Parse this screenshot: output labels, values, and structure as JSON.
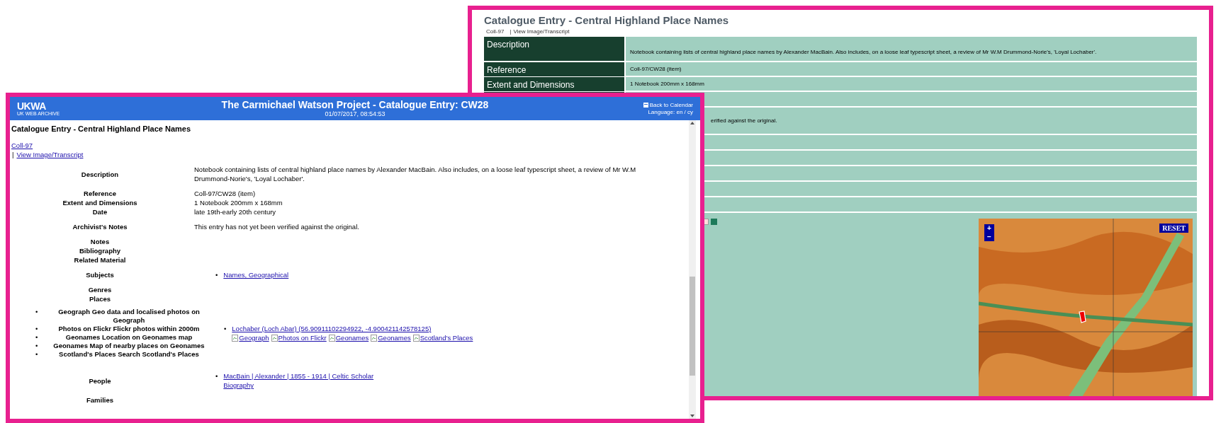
{
  "back_window": {
    "title": "Catalogue Entry - Central Highland Place Names",
    "links": [
      "Coll-97",
      "View Image/Transcript"
    ],
    "separator": "|",
    "rows": [
      {
        "label": "Description",
        "value": "Notebook containing lists of central highland place names by Alexander MacBain. Also includes, on a loose leaf typescript sheet, a review of Mr W.M Drummond-Norie's, 'Loyal Lochaber'."
      },
      {
        "label": "Reference",
        "value": "Coll-97/CW28 (item)"
      },
      {
        "label": "Extent and Dimensions",
        "value": "1 Notebook 200mm x 168mm"
      }
    ],
    "partly_covered_value": "erified against the original.",
    "map": {
      "zoom_in": "+",
      "zoom_out": "−",
      "reset_button": "RESET"
    }
  },
  "front_window": {
    "header": {
      "logo": "UKWA",
      "logo_subtitle": "UK WEB ARCHIVE",
      "title": "The Carmichael Watson Project - Catalogue Entry: CW28",
      "timestamp": "01/07/2017, 08:54:53",
      "back_link": "Back to Calendar",
      "language": "Language: en / cy"
    },
    "heading": "Catalogue Entry - Central Highland Place Names",
    "links": [
      "Coll-97",
      "View Image/Transcript"
    ],
    "separator": "|",
    "bullet": "•",
    "sections": [
      [
        {
          "kind": "text",
          "label": "Description",
          "value": "Notebook containing lists of central highland place names by Alexander MacBain. Also includes, on a loose leaf typescript sheet, a review of Mr W.M Drummond-Norie's, 'Loyal Lochaber'."
        }
      ],
      [
        {
          "kind": "text",
          "label": "Reference",
          "value": "Coll-97/CW28 (item)"
        },
        {
          "kind": "text",
          "label": "Extent and Dimensions",
          "value": "1 Notebook 200mm x 168mm"
        },
        {
          "kind": "text",
          "label": "Date",
          "value": "late 19th-early 20th century"
        }
      ],
      [
        {
          "kind": "text",
          "label": "Archivist's Notes",
          "value": "This entry has not yet been verified against the original."
        }
      ],
      [
        {
          "kind": "text",
          "label": "Notes"
        },
        {
          "kind": "text",
          "label": "Bibliography"
        },
        {
          "kind": "text",
          "label": "Related Material"
        }
      ],
      [
        {
          "kind": "links",
          "label": "Subjects",
          "links": [
            "Names, Geographical"
          ]
        }
      ],
      [
        {
          "kind": "text",
          "label": "Genres"
        },
        {
          "kind": "text",
          "label": "Places"
        }
      ],
      [
        {
          "kind": "places",
          "alts": [
            "Geograph Geo data and localised photos on Geograph",
            "Photos on Flickr Flickr photos within 2000m",
            "Geonames Location on Geonames map",
            "Geonames Map of nearby places on Geonames",
            "Scotland's Places Search Scotland's Places"
          ],
          "place_link": "Lochaber (Loch Abar) (56.90911102294922, -4.900421142578125)",
          "image_links": [
            "Geograph",
            "Photos on Flickr",
            "Geonames",
            "Geonames",
            "Scotland's Places"
          ]
        }
      ],
      [
        {
          "kind": "people",
          "label": "People",
          "links": [
            "MacBain | Alexander | 1855 - 1914 | Celtic Scholar"
          ],
          "extra_link": "Biography"
        }
      ],
      [
        {
          "kind": "text",
          "label": "Families"
        }
      ]
    ]
  }
}
